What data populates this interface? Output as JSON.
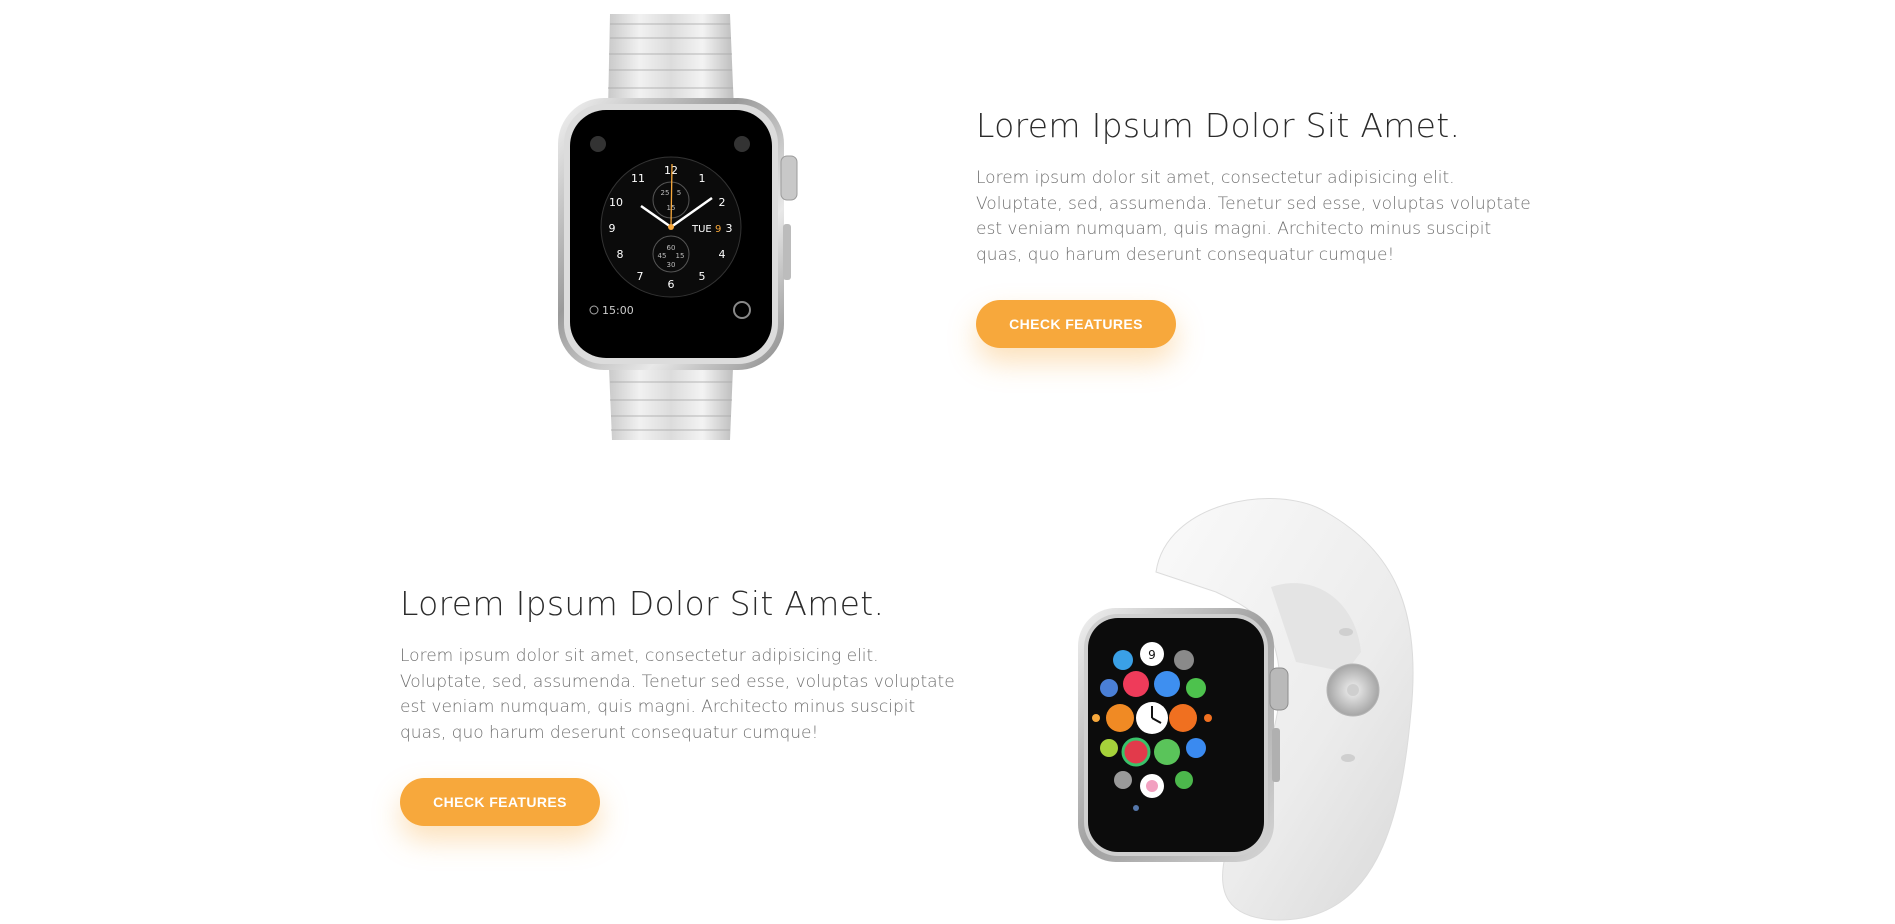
{
  "features": [
    {
      "heading": "Lorem Ipsum Dolor Sit Amet.",
      "body": "Lorem ipsum dolor sit amet, consectetur adipisicing elit. Voluptate, sed, assumenda. Tenetur sed esse, voluptas voluptate est veniam numquam, quis magni. Architecto minus suscipit quas, quo harum deserunt consequatur cumque!",
      "button_label": "CHECK FEATURES",
      "image": "steel-link-watch",
      "watch_face": {
        "day_date": "TUE",
        "date_num": "9",
        "time": "15:00"
      }
    },
    {
      "heading": "Lorem Ipsum Dolor Sit Amet.",
      "body": "Lorem ipsum dolor sit amet, consectetur adipisicing elit. Voluptate, sed, assumenda. Tenetur sed esse, voluptas voluptate est veniam numquam, quis magni. Architecto minus suscipit quas, quo harum deserunt consequatur cumque!",
      "button_label": "CHECK FEATURES",
      "image": "white-sport-band-watch",
      "watch_face": {
        "calendar_num": "9"
      }
    }
  ],
  "colors": {
    "accent": "#f7a83c",
    "heading": "#2b2b2b",
    "text": "#707070"
  }
}
